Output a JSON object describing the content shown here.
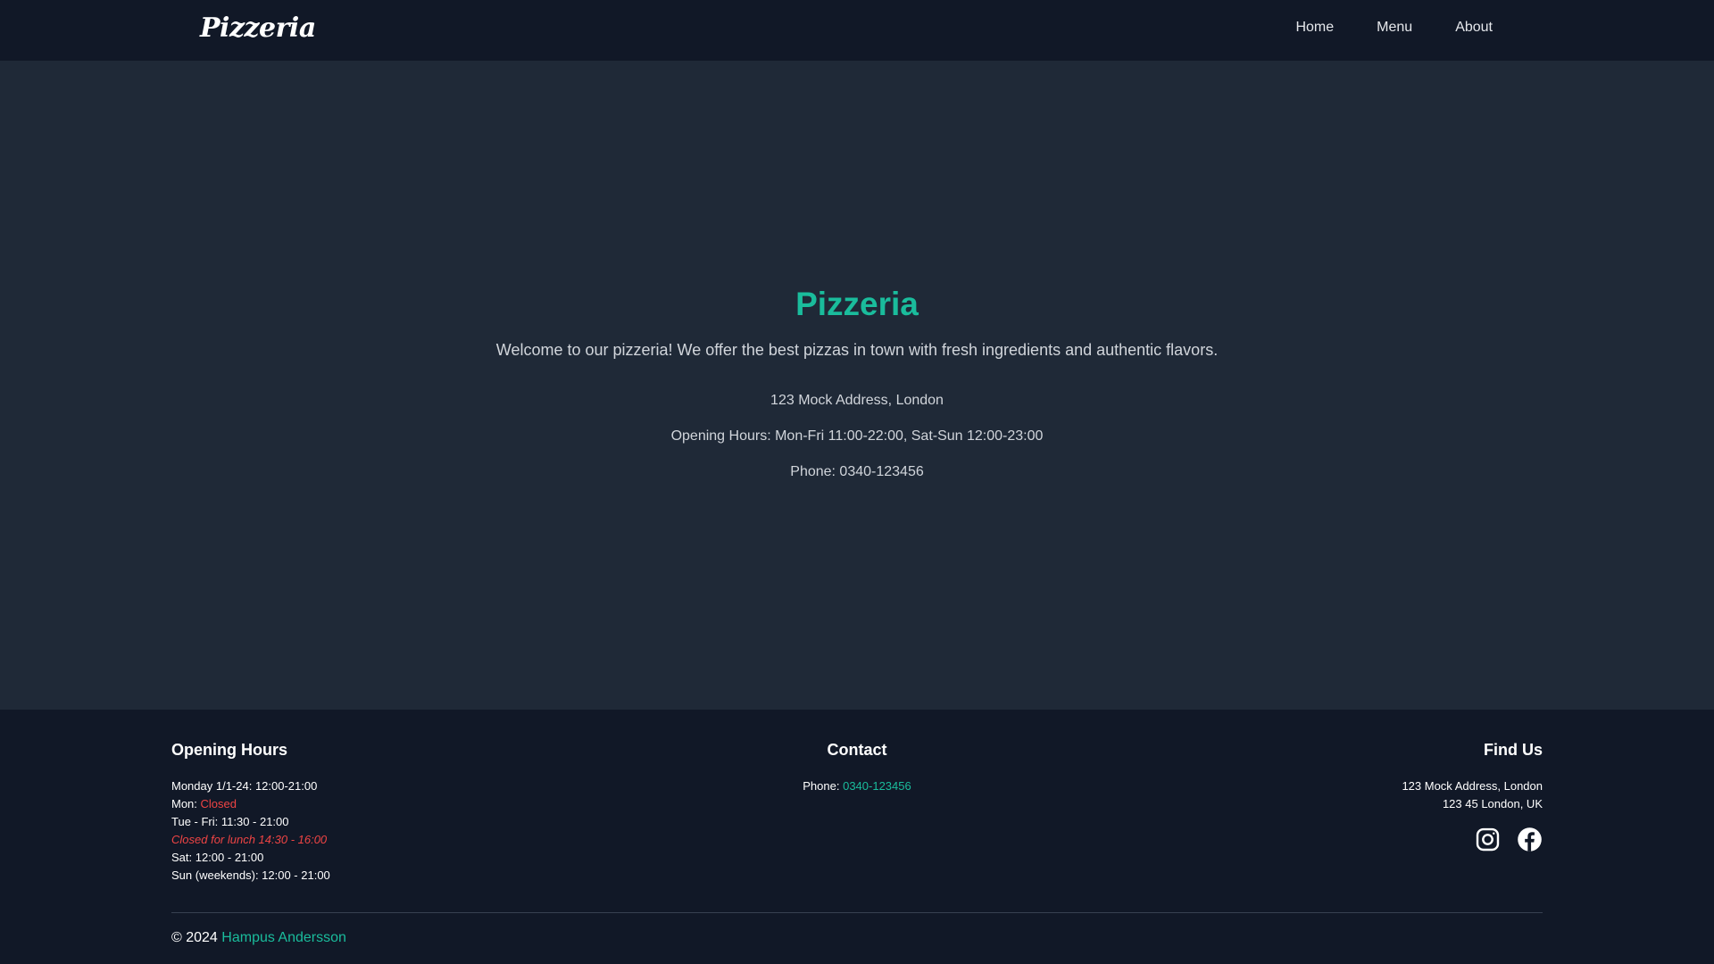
{
  "header": {
    "logo": "Pizzeria",
    "nav": [
      "Home",
      "Menu",
      "About"
    ]
  },
  "hero": {
    "title": "Pizzeria",
    "description": "Welcome to our pizzeria! We offer the best pizzas in town with fresh ingredients and authentic flavors.",
    "address": "123 Mock Address, London",
    "hours": "Opening Hours: Mon-Fri 11:00-22:00, Sat-Sun 12:00-23:00",
    "phone": "Phone: 0340-123456"
  },
  "footer": {
    "opening_hours": {
      "title": "Opening Hours",
      "line1": "Monday 1/1-24: 12:00-21:00",
      "mon_label": "Mon: ",
      "mon_status": "Closed",
      "line3": "Tue - Fri: 11:30 - 21:00",
      "lunch_note": "Closed for lunch 14:30 - 16:00",
      "line5": "Sat: 12:00 - 21:00",
      "line6": "Sun (weekends): 12:00 - 21:00"
    },
    "contact": {
      "title": "Contact",
      "phone_label": "Phone: ",
      "phone_value": "0340-123456"
    },
    "find_us": {
      "title": "Find Us",
      "address_line1": "123 Mock Address, London",
      "address_line2": "123 45 London, UK"
    },
    "copyright_prefix": "© 2024 ",
    "copyright_name": "Hampus Andersson"
  },
  "icons": {
    "instagram": "instagram-icon",
    "facebook": "facebook-icon"
  },
  "colors": {
    "accent": "#1abc9c",
    "alert": "#ef4444",
    "header_bg": "#111827",
    "page_bg": "#1f2937"
  }
}
